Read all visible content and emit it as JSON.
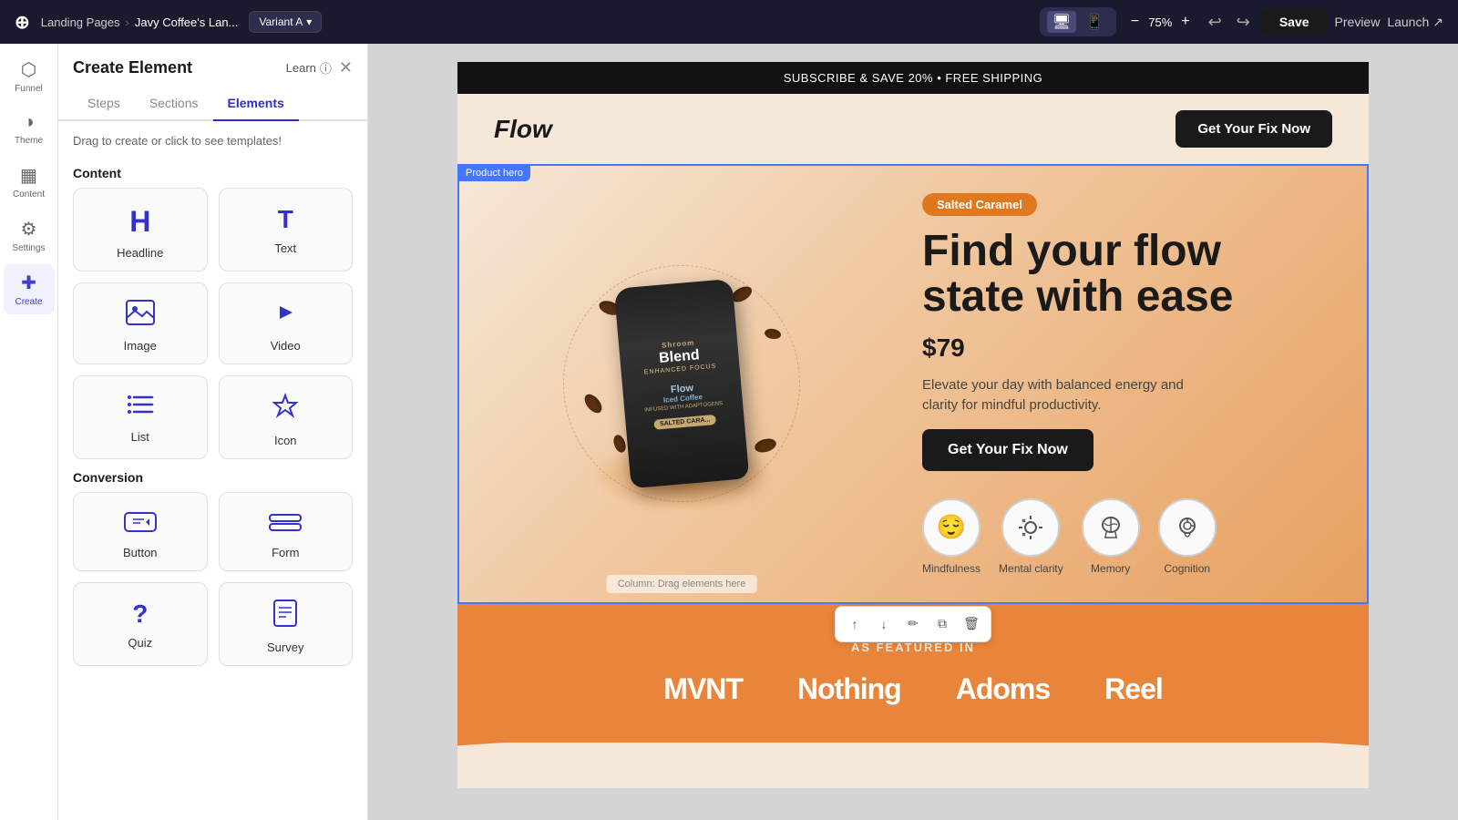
{
  "topbar": {
    "logo": "⊕",
    "breadcrumb_root": "Landing Pages",
    "breadcrumb_current": "Javy Coffee's Lan...",
    "variant_label": "Variant A",
    "zoom_value": "75%",
    "save_label": "Save",
    "preview_label": "Preview",
    "launch_label": "Launch"
  },
  "sidebar_icons": [
    {
      "id": "funnel",
      "symbol": "⬡",
      "label": "Funnel"
    },
    {
      "id": "theme",
      "symbol": "◑",
      "label": "Theme"
    },
    {
      "id": "content",
      "symbol": "▦",
      "label": "Content"
    },
    {
      "id": "settings",
      "symbol": "⚙",
      "label": "Settings"
    },
    {
      "id": "create",
      "symbol": "+",
      "label": "Create",
      "active": true
    }
  ],
  "panel": {
    "title": "Create Element",
    "learn_label": "Learn",
    "tabs": [
      "Steps",
      "Sections",
      "Elements"
    ],
    "active_tab": "Elements",
    "subtitle": "Drag to create or click to see templates!",
    "content_section": "Content",
    "conversion_section": "Conversion",
    "elements": [
      {
        "id": "headline",
        "label": "Headline",
        "icon": "H"
      },
      {
        "id": "text",
        "label": "Text",
        "icon": "T"
      },
      {
        "id": "image",
        "label": "Image",
        "icon": "🖼"
      },
      {
        "id": "video",
        "label": "Video",
        "icon": "▶"
      },
      {
        "id": "list",
        "label": "List",
        "icon": "≡"
      },
      {
        "id": "icon",
        "label": "Icon",
        "icon": "☆"
      }
    ],
    "conversion_elements": [
      {
        "id": "button",
        "label": "Button",
        "icon": "⊟"
      },
      {
        "id": "form",
        "label": "Form",
        "icon": "▬"
      },
      {
        "id": "quiz",
        "label": "Quiz",
        "icon": "?"
      },
      {
        "id": "survey",
        "label": "Survey",
        "icon": "📋"
      }
    ]
  },
  "canvas": {
    "topbar_text": "SUBSCRIBE & SAVE 20% • FREE SHIPPING",
    "logo": "Flow",
    "header_cta": "Get Your Fix Now",
    "hero": {
      "label_tag": "Product hero",
      "badge": "Salted Caramel",
      "title_line1": "Find your flow",
      "title_line2": "state with ease",
      "price": "$79",
      "description": "Elevate your day with balanced energy and clarity for mindful productivity.",
      "cta_button": "Get Your Fix Now",
      "drag_hint": "Column: Drag elements here",
      "benefits": [
        {
          "label": "Mindfulness",
          "icon": "😌"
        },
        {
          "label": "Mental clarity",
          "icon": "☀"
        },
        {
          "label": "Memory",
          "icon": "🧠"
        },
        {
          "label": "Cognition",
          "icon": "🧠"
        }
      ]
    },
    "featured_label": "AS FEATURED IN",
    "featured_logos": [
      "MVNT",
      "Nothing",
      "Adoms",
      "Reel"
    ]
  },
  "toolbar_buttons": [
    "↑",
    "↓",
    "✏",
    "⧉",
    "🗑"
  ]
}
